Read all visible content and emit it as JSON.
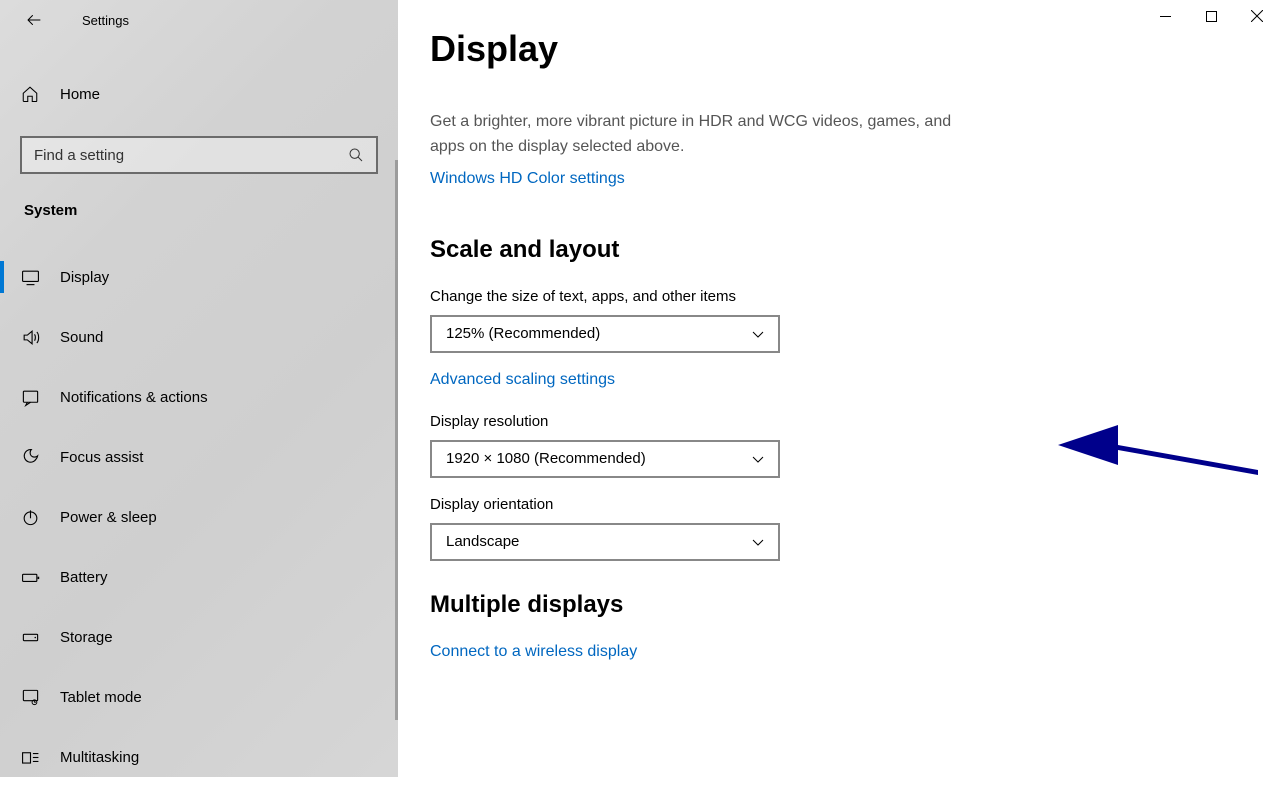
{
  "window": {
    "title": "Settings"
  },
  "sidebar": {
    "home": "Home",
    "search_placeholder": "Find a setting",
    "category": "System",
    "items": [
      {
        "label": "Display",
        "icon": "display-icon"
      },
      {
        "label": "Sound",
        "icon": "sound-icon"
      },
      {
        "label": "Notifications & actions",
        "icon": "notifications-icon"
      },
      {
        "label": "Focus assist",
        "icon": "focus-assist-icon"
      },
      {
        "label": "Power & sleep",
        "icon": "power-icon"
      },
      {
        "label": "Battery",
        "icon": "battery-icon"
      },
      {
        "label": "Storage",
        "icon": "storage-icon"
      },
      {
        "label": "Tablet mode",
        "icon": "tablet-icon"
      },
      {
        "label": "Multitasking",
        "icon": "multitasking-icon"
      }
    ]
  },
  "main": {
    "title": "Display",
    "hdr_desc": "Get a brighter, more vibrant picture in HDR and WCG videos, games, and apps on the display selected above.",
    "link_hdcolor": "Windows HD Color settings",
    "section_scale": "Scale and layout",
    "label_scale": "Change the size of text, apps, and other items",
    "val_scale": "125% (Recommended)",
    "link_adv_scaling": "Advanced scaling settings",
    "label_res": "Display resolution",
    "val_res": "1920 × 1080 (Recommended)",
    "label_orient": "Display orientation",
    "val_orient": "Landscape",
    "section_multi": "Multiple displays",
    "link_wireless": "Connect to a wireless display"
  }
}
